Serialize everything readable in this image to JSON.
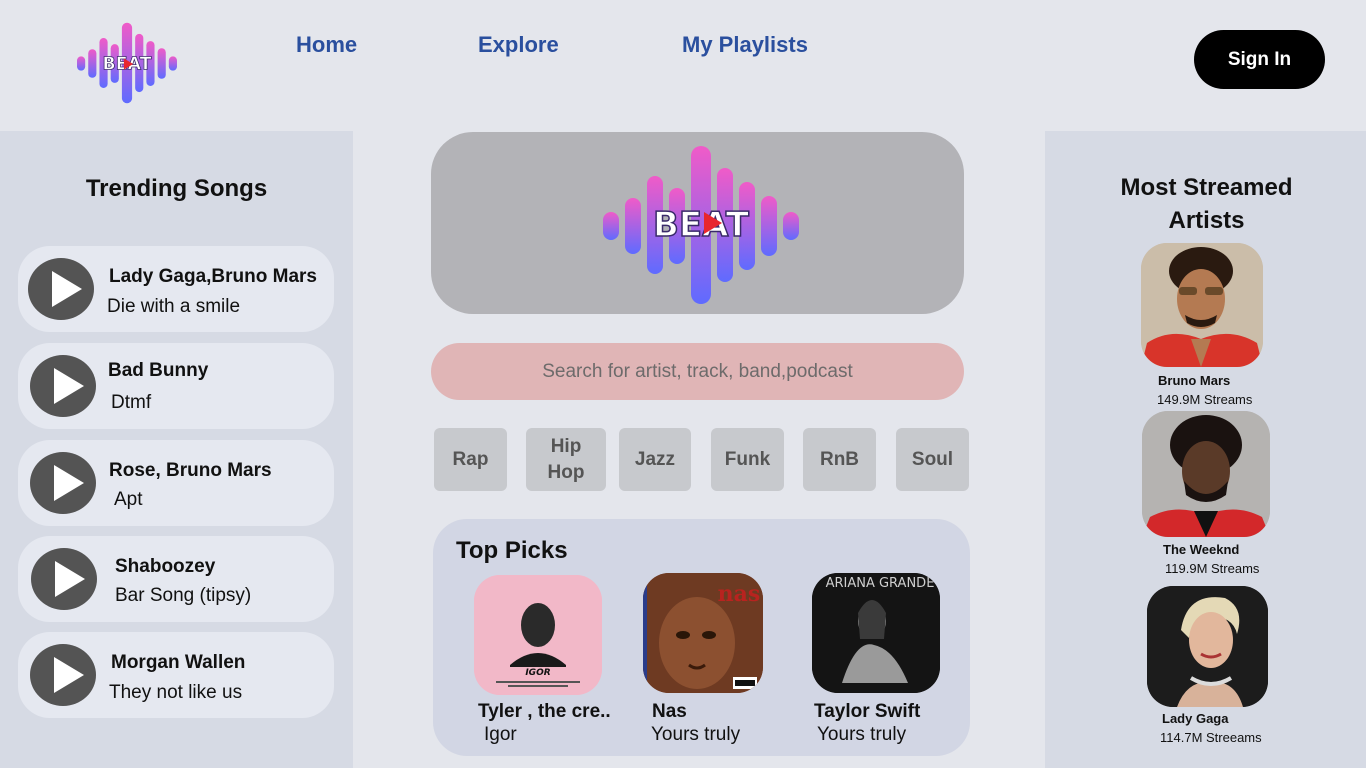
{
  "brand": {
    "logo_text": "BEAT"
  },
  "nav": {
    "home": "Home",
    "explore": "Explore",
    "my_playlists": "My Playlists",
    "sign_in": "Sign In"
  },
  "trending": {
    "title": "Trending Songs",
    "songs": [
      {
        "artist": "Lady Gaga,Bruno Mars",
        "title": "Die with a smile"
      },
      {
        "artist": "Bad Bunny",
        "title": "Dtmf"
      },
      {
        "artist": "Rose, Bruno Mars",
        "title": "Apt"
      },
      {
        "artist": "Shaboozey",
        "title": "Bar Song (tipsy)"
      },
      {
        "artist": "Morgan Wallen",
        "title": "They not like us"
      }
    ]
  },
  "search": {
    "placeholder": "Search for artist, track, band,podcast"
  },
  "genres": [
    "Rap",
    "Hip Hop",
    "Jazz",
    "Funk",
    "RnB",
    "Soul"
  ],
  "top_picks": {
    "title": "Top Picks",
    "items": [
      {
        "artist": "Tyler , the cre..",
        "title": "Igor",
        "cover_text": "IGOR"
      },
      {
        "artist": "Nas",
        "title": "Yours truly",
        "cover_text": "nas"
      },
      {
        "artist": "Taylor Swift",
        "title": "Yours truly",
        "cover_text": "ARIANA GRANDE"
      }
    ]
  },
  "most_streamed": {
    "title_line1": "Most Streamed",
    "title_line2": "Artists",
    "artists": [
      {
        "name": "Bruno Mars",
        "streams": "149.9M Streams"
      },
      {
        "name": "The Weeknd",
        "streams": "119.9M Streams"
      },
      {
        "name": "Lady Gaga",
        "streams": "114.7M Streeams"
      }
    ]
  },
  "colors": {
    "accent_nav": "#2a4f9e",
    "logo_pink": "#f05bc8",
    "logo_blue": "#5f6bff",
    "search_bg": "#e0b5b6",
    "hero_bg": "#b3b3b7",
    "panel_bg": "#d6dae4"
  }
}
